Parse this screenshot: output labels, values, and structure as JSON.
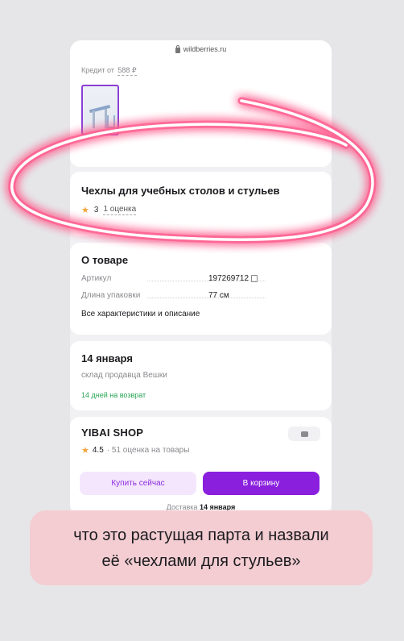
{
  "browser": {
    "url": "wildberries.ru"
  },
  "product": {
    "credit_label": "Кредит от",
    "credit_amount": "588 ₽",
    "title": "Чехлы для учебных столов и стульев",
    "rating": "3",
    "reviews": "1 оценка"
  },
  "about": {
    "title": "О товаре",
    "specs": [
      {
        "key": "Артикул",
        "value": "197269712"
      },
      {
        "key": "Длина упаковки",
        "value": "77 см"
      }
    ],
    "all_link": "Все характеристики и описание"
  },
  "delivery": {
    "date": "14 января",
    "warehouse": "склад продавца Вешки",
    "return_policy": "14 дней на возврат"
  },
  "shop": {
    "name": "YIBAI SHOP",
    "rating": "4.5",
    "rating_text": "· 51 оценка на товары"
  },
  "actions": {
    "buy_now": "Купить сейчас",
    "add_to_cart": "В корзину",
    "delivery_label": "Доставка",
    "delivery_date": "14 января"
  },
  "caption": {
    "line1": "что это растущая парта и назвали",
    "line2": "её «чехлами для стульев»"
  },
  "colors": {
    "accent": "#8a1fde",
    "highlight_ring": "#ff5a8c",
    "caption_bg": "#f3cdd2",
    "return_green": "#27a354"
  }
}
